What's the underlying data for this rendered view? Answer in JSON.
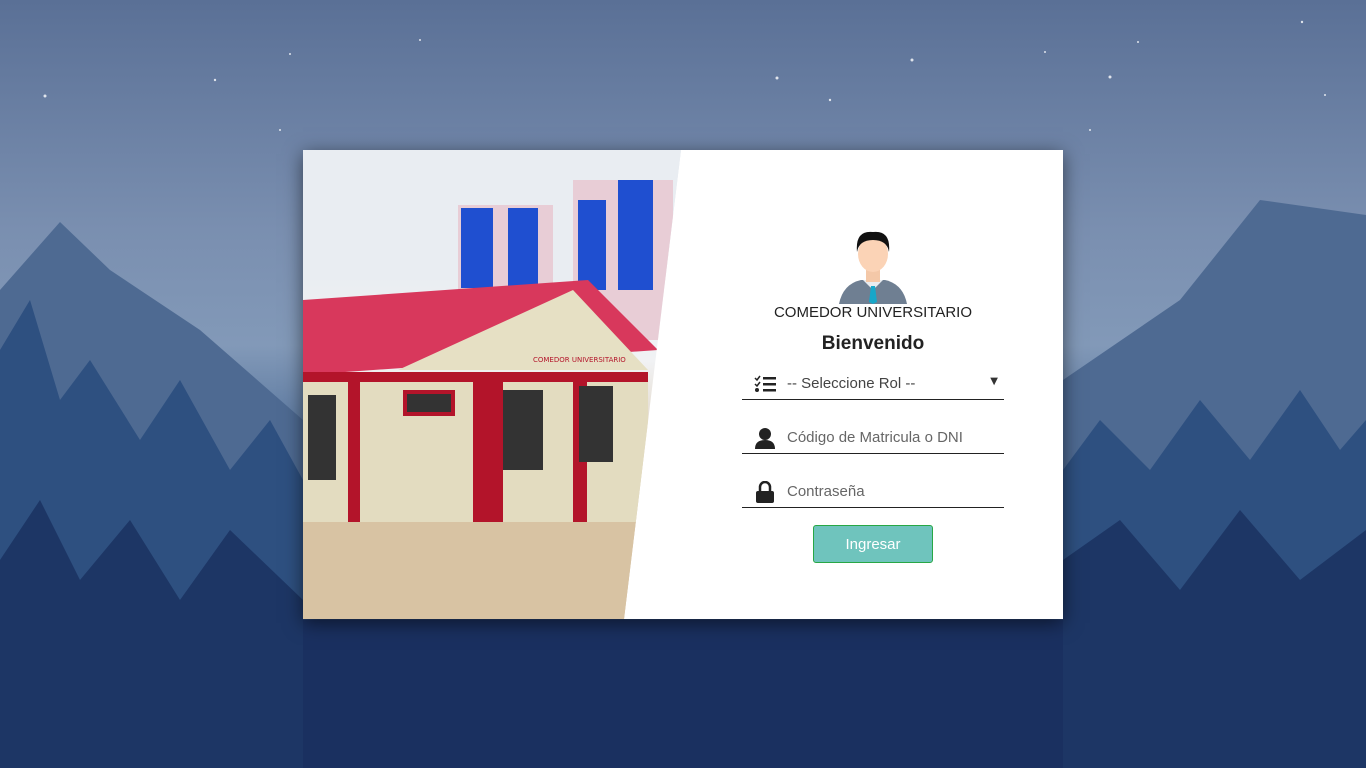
{
  "brand": {
    "title": "COMEDOR UNIVERSITARIO",
    "welcome": "Bienvenido"
  },
  "photo": {
    "sign_text": "COMEDOR UNIVERSITARIO"
  },
  "form": {
    "role_select": {
      "value": "-- Seleccione Rol --",
      "icon": "checklist-icon"
    },
    "username": {
      "placeholder": "Código de Matricula o DNI",
      "icon": "user-icon"
    },
    "password": {
      "placeholder": "Contraseña",
      "icon": "lock-icon"
    },
    "submit_label": "Ingresar"
  },
  "colors": {
    "button": "#6fc4bd",
    "button_border": "#28a745",
    "roof": "#d8385c",
    "trim": "#b3142a"
  }
}
